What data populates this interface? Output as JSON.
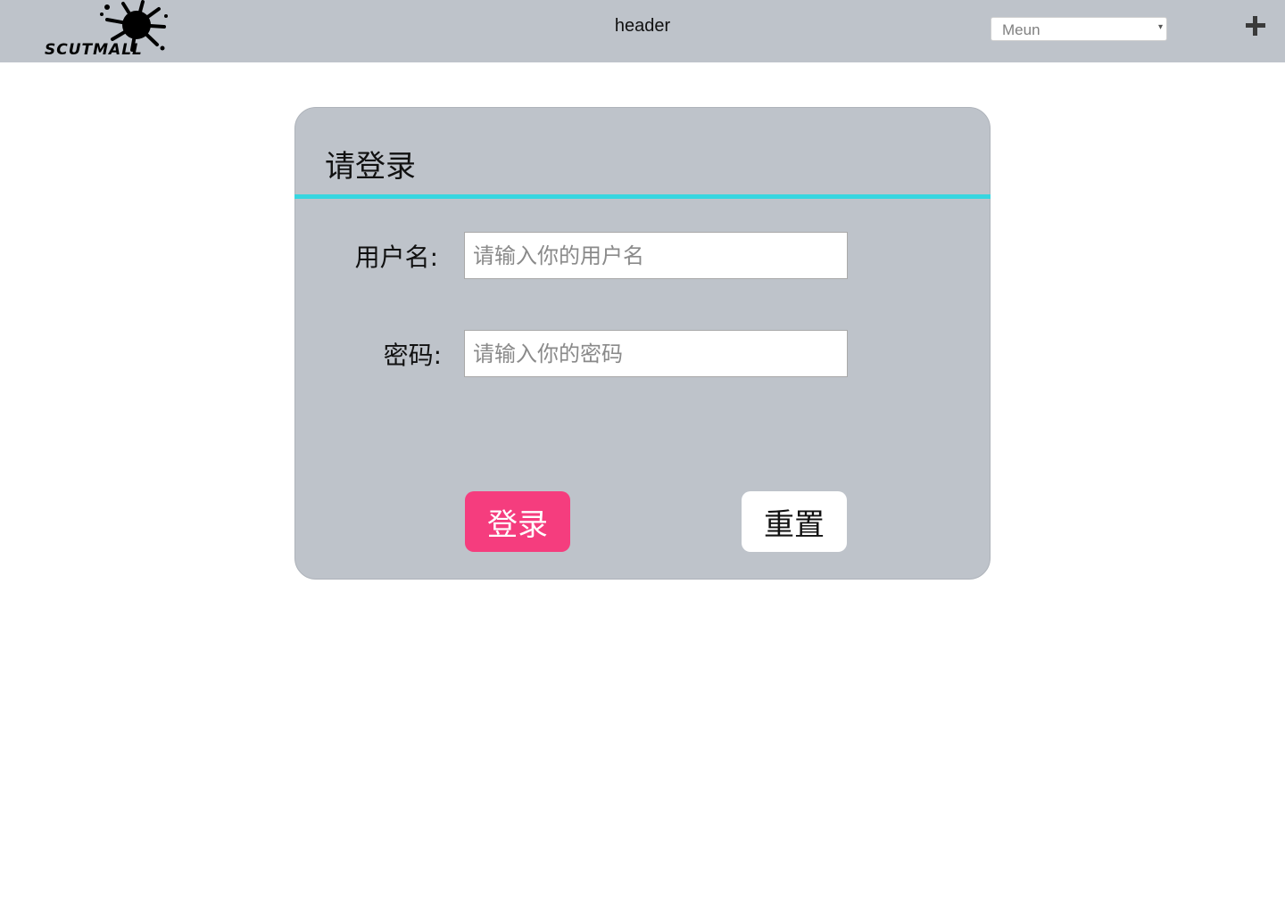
{
  "header": {
    "logo_text": "SCUTMALL",
    "title": "header",
    "menu": {
      "selected": "Meun",
      "arrow": "▾"
    },
    "add_icon": "plus-icon"
  },
  "login": {
    "title": "请登录",
    "username": {
      "label": "用户名:",
      "placeholder": "请输入你的用户名",
      "value": ""
    },
    "password": {
      "label": "密码:",
      "placeholder": "请输入你的密码",
      "value": ""
    },
    "login_button": "登录",
    "reset_button": "重置"
  },
  "colors": {
    "header_bg": "#bec3ca",
    "card_bg": "#bec3ca",
    "divider": "#36d6e0",
    "login_button_bg": "#f53d7e",
    "reset_button_bg": "#ffffff"
  }
}
